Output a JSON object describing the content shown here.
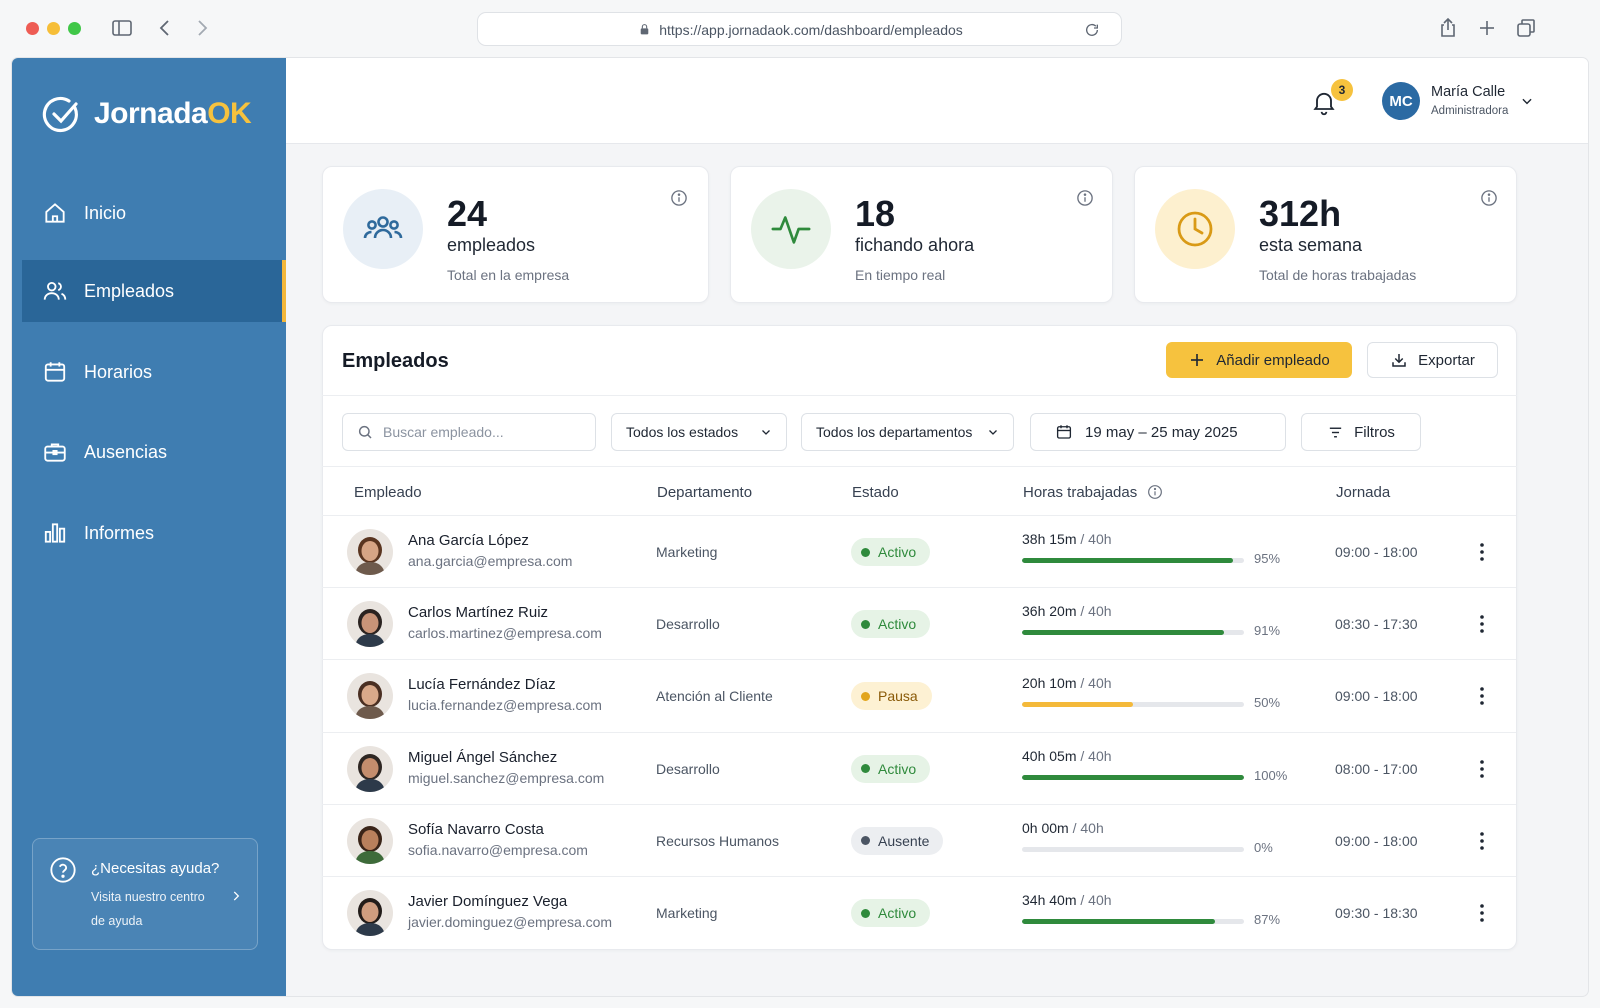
{
  "browser": {
    "url": "https://app.jornadaok.com/dashboard/empleados"
  },
  "brand": {
    "name_part1": "Jornada",
    "name_part2": "OK"
  },
  "sidebar": {
    "items": [
      {
        "label": "Inicio",
        "icon": "home-icon"
      },
      {
        "label": "Empleados",
        "icon": "users-icon",
        "active": true
      },
      {
        "label": "Horarios",
        "icon": "calendar-icon"
      },
      {
        "label": "Ausencias",
        "icon": "briefcase-icon"
      },
      {
        "label": "Informes",
        "icon": "bar-chart-icon"
      }
    ],
    "help": {
      "title": "¿Necesitas ayuda?",
      "line1": "Visita nuestro centro",
      "line2": "de ayuda"
    }
  },
  "header": {
    "notifications": "3",
    "user_initials": "MC",
    "user_name": "María Calle",
    "user_role": "Administradora"
  },
  "stats": [
    {
      "value": "24",
      "label": "empleados",
      "sub": "Total en la empresa",
      "icon": "people-icon"
    },
    {
      "value": "18",
      "label": "fichando ahora",
      "sub": "En tiempo real",
      "icon": "activity-icon"
    },
    {
      "value": "312h",
      "label": "esta semana",
      "sub": "Total de horas trabajadas",
      "icon": "clock-icon"
    }
  ],
  "employees_panel": {
    "title": "Empleados",
    "add_button": "Añadir empleado",
    "export_button": "Exportar",
    "search_placeholder": "Buscar empleado...",
    "status_filter": "Todos los estados",
    "dept_filter": "Todos los departamentos",
    "date_range": "19 may – 25 may 2025",
    "filters_button": "Filtros",
    "columns": [
      "Empleado",
      "Departamento",
      "Estado",
      "Horas trabajadas",
      "Jornada"
    ]
  },
  "rows": [
    {
      "name": "Ana García López",
      "email": "ana.garcia@empresa.com",
      "dept": "Marketing",
      "status": "Activo",
      "hours": "38h 15m",
      "total": "40h",
      "pct": "95%",
      "progress": 0.95,
      "schedule": "09:00 - 18:00"
    },
    {
      "name": "Carlos Martínez Ruiz",
      "email": "carlos.martinez@empresa.com",
      "dept": "Desarrollo",
      "status": "Activo",
      "hours": "36h 20m",
      "total": "40h",
      "pct": "91%",
      "progress": 0.91,
      "schedule": "08:30 - 17:30"
    },
    {
      "name": "Lucía Fernández Díaz",
      "email": "lucia.fernandez@empresa.com",
      "dept": "Atención al Cliente",
      "status": "Pausa",
      "hours": "20h 10m",
      "total": "40h",
      "pct": "50%",
      "progress": 0.5,
      "schedule": "09:00 - 18:00"
    },
    {
      "name": "Miguel Ángel Sánchez",
      "email": "miguel.sanchez@empresa.com",
      "dept": "Desarrollo",
      "status": "Activo",
      "hours": "40h 05m",
      "total": "40h",
      "pct": "100%",
      "progress": 1.0,
      "schedule": "08:00 - 17:00"
    },
    {
      "name": "Sofía Navarro Costa",
      "email": "sofia.navarro@empresa.com",
      "dept": "Recursos Humanos",
      "status": "Ausente",
      "hours": "0h 00m",
      "total": "40h",
      "pct": "0%",
      "progress": 0,
      "schedule": "09:00 - 18:00"
    },
    {
      "name": "Javier Domínguez Vega",
      "email": "javier.dominguez@empresa.com",
      "dept": "Marketing",
      "status": "Activo",
      "hours": "34h 40m",
      "total": "40h",
      "pct": "87%",
      "progress": 0.87,
      "schedule": "09:30 - 18:30"
    }
  ],
  "colors": {
    "sidebar": "#3f7db1",
    "accent": "#f6c23e",
    "active_green": "#2f8a3c",
    "pause_yellow": "#f4b93a",
    "absent_gray": "#4b5563"
  }
}
